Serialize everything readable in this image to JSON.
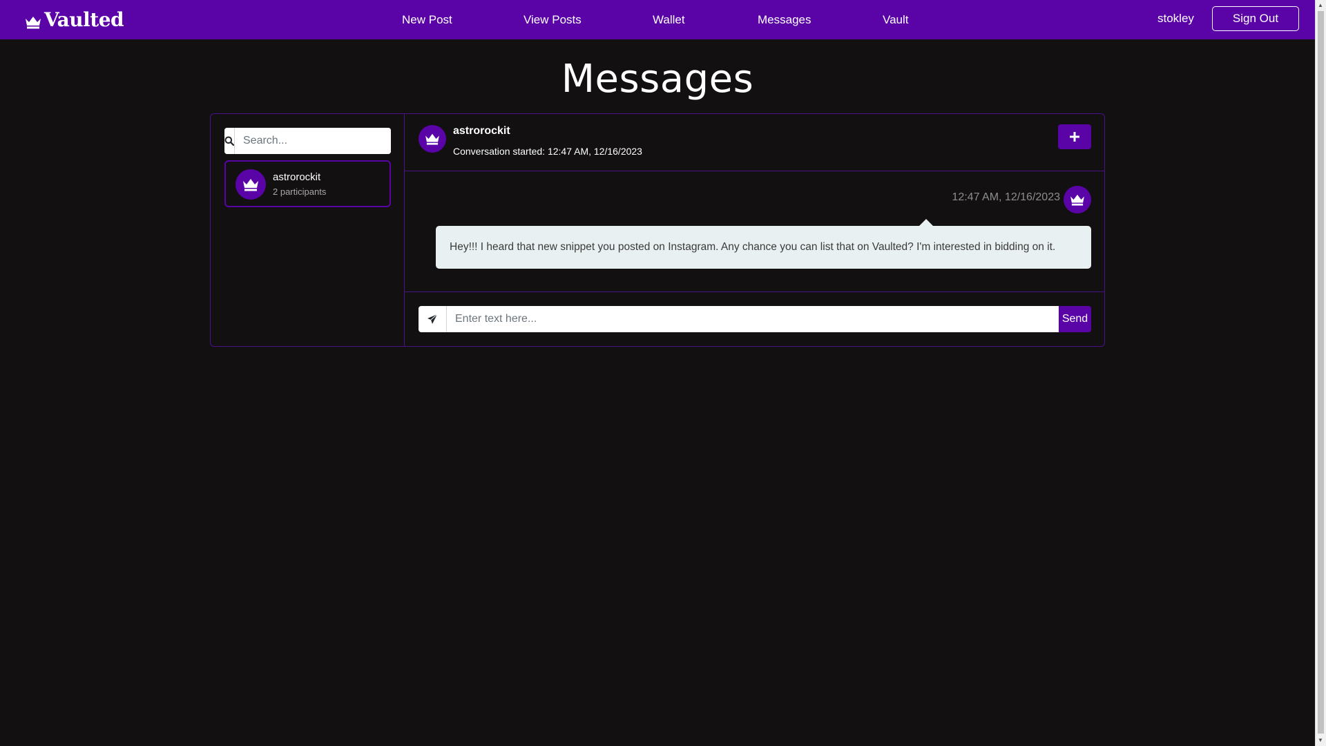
{
  "brand": {
    "name": "Vaulted",
    "icon": "crown-icon"
  },
  "nav": {
    "links": [
      "New Post",
      "View Posts",
      "Wallet",
      "Messages",
      "Vault"
    ],
    "username": "stokley",
    "sign_out_label": "Sign Out"
  },
  "page": {
    "title": "Messages"
  },
  "sidebar": {
    "search_placeholder": "Search...",
    "conversations": [
      {
        "name": "astrorockit",
        "participants": "2 participants"
      }
    ]
  },
  "chat": {
    "title": "astrorockit",
    "started": "Conversation started: 12:47 AM, 12/16/2023",
    "add_icon": "plus-icon",
    "messages": [
      {
        "time": "12:47 AM, 12/16/2023",
        "text": "Hey!!! I heard that new snippet you posted on Instagram. Any chance you can list that on Vaulted? I'm interested in bidding on it."
      }
    ],
    "compose_placeholder": "Enter text here...",
    "send_label": "Send"
  },
  "colors": {
    "accent": "#5a04a8",
    "background": "#121011",
    "bubble": "#e9f0f1"
  }
}
